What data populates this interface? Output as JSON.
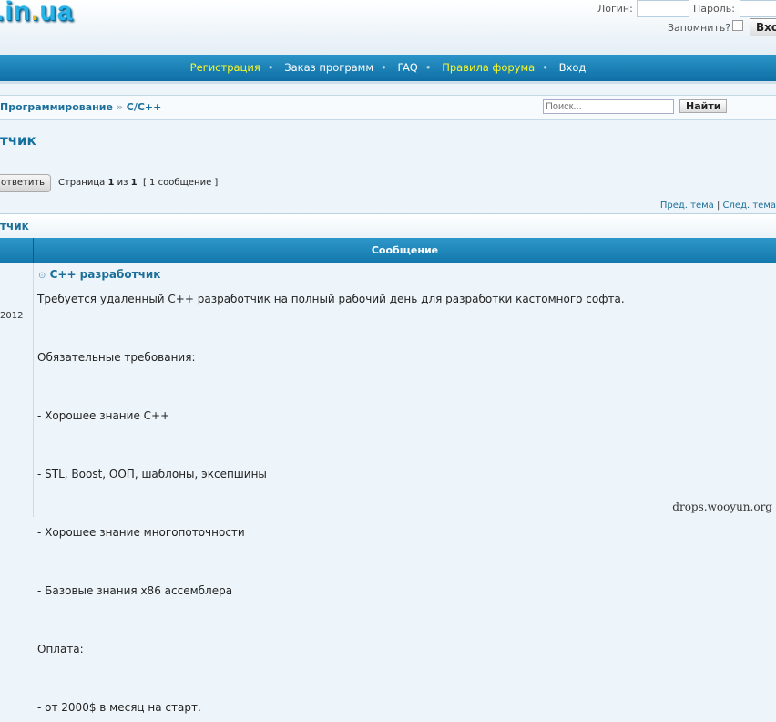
{
  "logo": {
    "text_a": "",
    "dot": ".",
    "text_b": "in",
    "dot2": ".",
    "text_c": "ua",
    "full": "in.ua"
  },
  "login": {
    "login_label": "Логин:",
    "password_label": "Пароль:",
    "remember_label": "Запомнить?",
    "submit": "Вхо"
  },
  "nav": [
    {
      "label": "Регистрация",
      "highlight": true
    },
    {
      "label": "Заказ программ",
      "highlight": false
    },
    {
      "label": "FAQ",
      "highlight": false
    },
    {
      "label": "Правила форума",
      "highlight": true
    },
    {
      "label": "Вход",
      "highlight": false
    }
  ],
  "breadcrumb": {
    "parent": "Программирование",
    "sep": "»",
    "current": "C/C++"
  },
  "search": {
    "placeholder": "Поиск...",
    "button": "Найти"
  },
  "topic_title": "тчик",
  "reply_button": "ответить",
  "pagination": {
    "prefix": "Страница",
    "current": "1",
    "of": "из",
    "total": "1",
    "count": "[ 1 сообщение ]"
  },
  "topic_nav": {
    "prev": "Пред. тема",
    "sep": "|",
    "next": "След. тема"
  },
  "section_title": "тчик",
  "table_header": "Сообщение",
  "post": {
    "date": "2012",
    "icon": "⊙",
    "title": "C++ разработчик",
    "lines": [
      "Требуется удаленный C++ разработчик на полный рабочий день для разработки кастомного софта.",
      "",
      "Обязательные требования:",
      "",
      "- Хорошее знание C++",
      "",
      "- STL, Boost, ООП, шаблоны, эксепшины",
      "",
      "- Хорошее знание многопоточности",
      "",
      "- Базовые знания x86 ассемблера",
      "",
      "Оплата:",
      "",
      "- от 2000$ в месяц на старт."
    ]
  },
  "watermark": "drops.wooyun.org"
}
